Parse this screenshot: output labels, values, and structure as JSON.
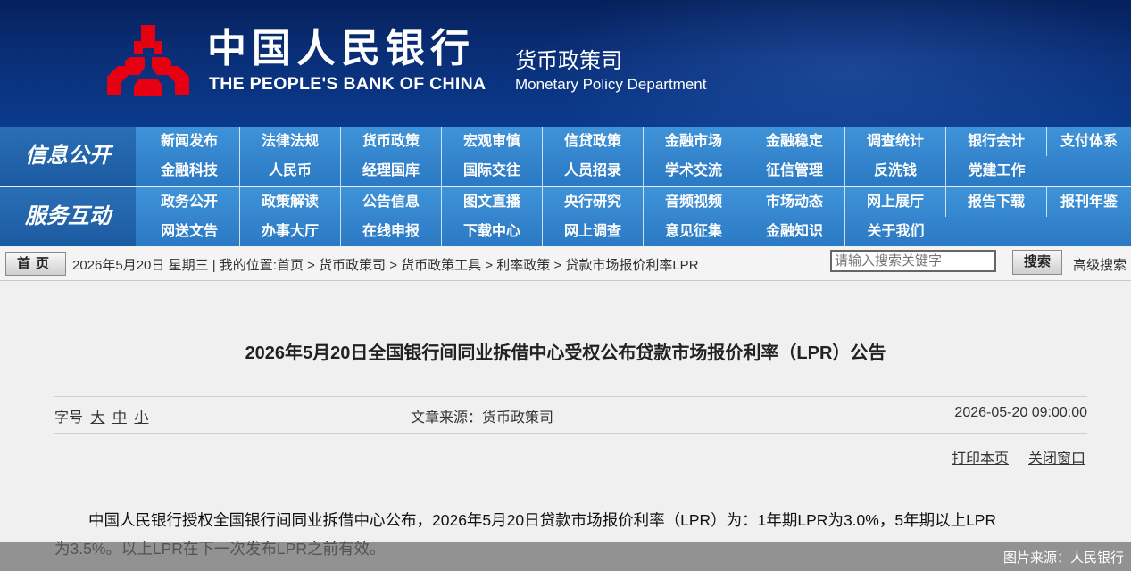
{
  "header": {
    "bank_name_cn": "中国人民银行",
    "bank_name_en": "THE PEOPLE'S BANK OF CHINA",
    "dept_cn": "货币政策司",
    "dept_en": "Monetary Policy Department"
  },
  "nav": {
    "info_title": "信息公开",
    "service_title": "服务互动",
    "info_row1": [
      "新闻发布",
      "法律法规",
      "货币政策",
      "宏观审慎",
      "信贷政策",
      "金融市场",
      "金融稳定",
      "调查统计",
      "银行会计",
      "支付体系"
    ],
    "info_row2": [
      "金融科技",
      "人民币",
      "经理国库",
      "国际交往",
      "人员招录",
      "学术交流",
      "征信管理",
      "反洗钱",
      "党建工作"
    ],
    "service_row1": [
      "政务公开",
      "政策解读",
      "公告信息",
      "图文直播",
      "央行研究",
      "音频视频",
      "市场动态",
      "网上展厅",
      "报告下载",
      "报刊年鉴"
    ],
    "service_row2": [
      "网送文告",
      "办事大厅",
      "在线申报",
      "下载中心",
      "网上调查",
      "意见征集",
      "金融知识",
      "关于我们"
    ]
  },
  "crumbbar": {
    "home": "首页",
    "date_location": "2026年5月20日  星期三 | 我的位置:首页 > 货币政策司 > 货币政策工具 > 利率政策 > 贷款市场报价利率LPR",
    "search_placeholder": "请输入搜索关键字",
    "search_button": "搜索",
    "advanced_search": "高级搜索"
  },
  "article": {
    "title": "2026年5月20日全国银行间同业拆借中心受权公布贷款市场报价利率（LPR）公告",
    "font_size_label": "字号",
    "font_large": "大",
    "font_medium": "中",
    "font_small": "小",
    "source": "文章来源：货币政策司",
    "datetime": "2026-05-20 09:00:00",
    "print": "打印本页",
    "close": "关闭窗口",
    "body_line1": "中国人民银行授权全国银行间同业拆借中心公布，2026年5月20日贷款市场报价利率（LPR）为：1年期LPR为3.0%，5年期以上LPR",
    "body_line2": "为3.5%。以上LPR在下一次发布LPR之前有效。"
  },
  "caption": "图片来源：人民银行",
  "colors": {
    "banner": "#0a2f78",
    "nav": "#2b79c4",
    "nav_title": "#1c5aa0"
  }
}
